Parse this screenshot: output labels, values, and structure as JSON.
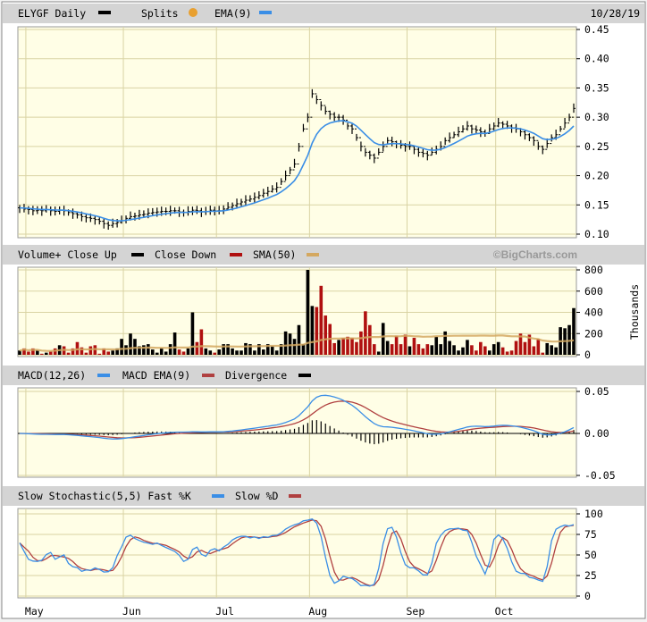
{
  "header": {
    "symbol_label": "ELYGF Daily",
    "splits_label": "Splits",
    "ema_label": "EMA(9)",
    "date": "10/28/19"
  },
  "volume_header": {
    "volume_label": "Volume+ Close Up",
    "close_down_label": "Close Down",
    "sma_label": "SMA(50)",
    "watermark": "©BigCharts.com",
    "unit_label": "Thousands"
  },
  "macd_header": {
    "macd_label": "MACD(12,26)",
    "macd_ema_label": "MACD EMA(9)",
    "divergence_label": "Divergence"
  },
  "stoch_header": {
    "label": "Slow Stochastic(5,5) Fast %K",
    "slow_label": "Slow %D"
  },
  "colors": {
    "plot_bg": "#fffee6",
    "grid": "#d9d3a3",
    "header_bg": "#d4d4d4",
    "ema": "#3a8ee6",
    "up": "#000000",
    "down": "#b01010",
    "sma": "#d4a860",
    "fastk": "#3a8ee6",
    "slowd": "#b04040",
    "splits": "#e8a030"
  },
  "chart_data": [
    {
      "type": "ohlc",
      "title": "ELYGF Daily",
      "ylim": [
        0.1,
        0.45
      ],
      "yticks": [
        "0.45",
        "0.40",
        "0.35",
        "0.30",
        "0.25",
        "0.20",
        "0.15",
        "0.10"
      ],
      "ytick_values": [
        0.45,
        0.4,
        0.35,
        0.3,
        0.25,
        0.2,
        0.15,
        0.1
      ],
      "months": [
        "May",
        "Jun",
        "Jul",
        "Aug",
        "Sep",
        "Oct"
      ],
      "month_start_index": [
        2,
        24,
        45,
        66,
        88,
        108
      ],
      "typical_range": 0.008,
      "close": [
        0.145,
        0.143,
        0.142,
        0.14,
        0.141,
        0.14,
        0.142,
        0.14,
        0.139,
        0.141,
        0.14,
        0.137,
        0.135,
        0.133,
        0.13,
        0.128,
        0.127,
        0.125,
        0.122,
        0.118,
        0.115,
        0.118,
        0.12,
        0.123,
        0.127,
        0.13,
        0.131,
        0.133,
        0.134,
        0.136,
        0.137,
        0.138,
        0.139,
        0.139,
        0.14,
        0.14,
        0.138,
        0.137,
        0.139,
        0.141,
        0.14,
        0.138,
        0.139,
        0.141,
        0.14,
        0.14,
        0.143,
        0.146,
        0.149,
        0.152,
        0.155,
        0.158,
        0.16,
        0.163,
        0.166,
        0.17,
        0.173,
        0.177,
        0.18,
        0.19,
        0.2,
        0.21,
        0.22,
        0.25,
        0.28,
        0.3,
        0.34,
        0.33,
        0.32,
        0.31,
        0.305,
        0.3,
        0.3,
        0.295,
        0.285,
        0.28,
        0.265,
        0.25,
        0.24,
        0.235,
        0.23,
        0.24,
        0.25,
        0.26,
        0.258,
        0.255,
        0.252,
        0.25,
        0.25,
        0.245,
        0.24,
        0.238,
        0.235,
        0.24,
        0.245,
        0.25,
        0.26,
        0.265,
        0.27,
        0.275,
        0.28,
        0.285,
        0.28,
        0.278,
        0.275,
        0.272,
        0.28,
        0.285,
        0.29,
        0.288,
        0.285,
        0.282,
        0.28,
        0.275,
        0.27,
        0.265,
        0.26,
        0.25,
        0.245,
        0.255,
        0.265,
        0.27,
        0.28,
        0.29,
        0.3,
        0.315
      ],
      "overlay": "EMA(9)"
    },
    {
      "type": "bar",
      "title": "Volume",
      "ylabel": "Thousands",
      "ylim": [
        0,
        800
      ],
      "yticks": [
        "800",
        "600",
        "400",
        "200",
        "0"
      ],
      "ytick_values": [
        800,
        600,
        400,
        200,
        0
      ],
      "values": [
        40,
        60,
        30,
        60,
        40,
        10,
        20,
        30,
        60,
        90,
        80,
        20,
        60,
        120,
        70,
        20,
        80,
        90,
        10,
        60,
        30,
        40,
        60,
        150,
        90,
        200,
        150,
        80,
        90,
        100,
        50,
        20,
        60,
        30,
        100,
        210,
        50,
        30,
        60,
        400,
        120,
        240,
        60,
        40,
        20,
        50,
        100,
        100,
        60,
        40,
        40,
        110,
        100,
        40,
        100,
        50,
        100,
        80,
        40,
        100,
        220,
        200,
        150,
        280,
        100,
        800,
        460,
        450,
        650,
        370,
        290,
        110,
        140,
        160,
        170,
        160,
        120,
        220,
        410,
        280,
        100,
        30,
        300,
        130,
        100,
        180,
        100,
        190,
        80,
        160,
        100,
        60,
        100,
        90,
        170,
        100,
        220,
        130,
        90,
        40,
        70,
        140,
        90,
        40,
        120,
        80,
        40,
        100,
        120,
        70,
        30,
        40,
        130,
        200,
        120,
        190,
        80,
        150,
        20,
        110,
        90,
        70,
        260,
        250,
        280,
        440
      ],
      "overlay": "SMA(50)"
    },
    {
      "type": "line",
      "title": "MACD(12,26)",
      "ylim": [
        -0.05,
        0.05
      ],
      "yticks": [
        "0.05",
        "0.00",
        "-0.05"
      ],
      "ytick_values": [
        0.05,
        0,
        -0.05
      ],
      "series": [
        "MACD(12,26)",
        "MACD EMA(9)",
        "Divergence"
      ]
    },
    {
      "type": "line",
      "title": "Slow Stochastic(5,5)",
      "ylim": [
        0,
        100
      ],
      "yticks": [
        "100",
        "75",
        "50",
        "25",
        "0"
      ],
      "ytick_values": [
        100,
        75,
        50,
        25,
        0
      ],
      "series": [
        "Fast %K",
        "Slow %D"
      ]
    }
  ]
}
